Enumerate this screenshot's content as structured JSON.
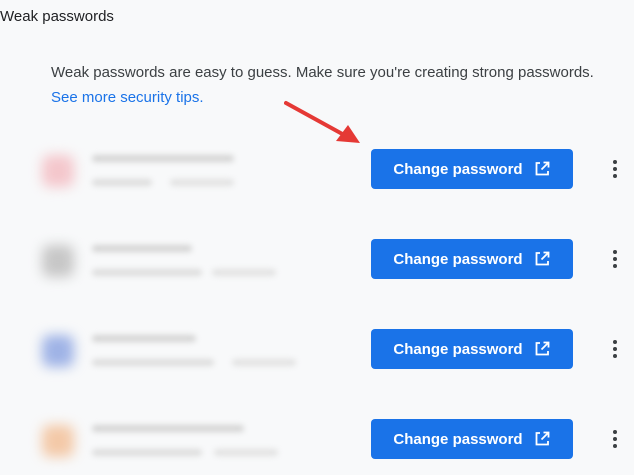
{
  "section": {
    "title": "Weak passwords",
    "description": "Weak passwords are easy to guess. Make sure you're creating strong passwords.",
    "tips_link": "See more security tips."
  },
  "rows": [
    {
      "button_label": "Change password",
      "icon_color": "#f4c7cc"
    },
    {
      "button_label": "Change password",
      "icon_color": "#c7c7c7"
    },
    {
      "button_label": "Change password",
      "icon_color": "#9fb3e6"
    },
    {
      "button_label": "Change password",
      "icon_color": "#f3c9a8"
    }
  ],
  "colors": {
    "accent": "#1a73e8",
    "annotation_arrow": "#e53935"
  },
  "icons": {
    "external_link": "open-in-new-icon",
    "menu": "more-vert-icon"
  }
}
